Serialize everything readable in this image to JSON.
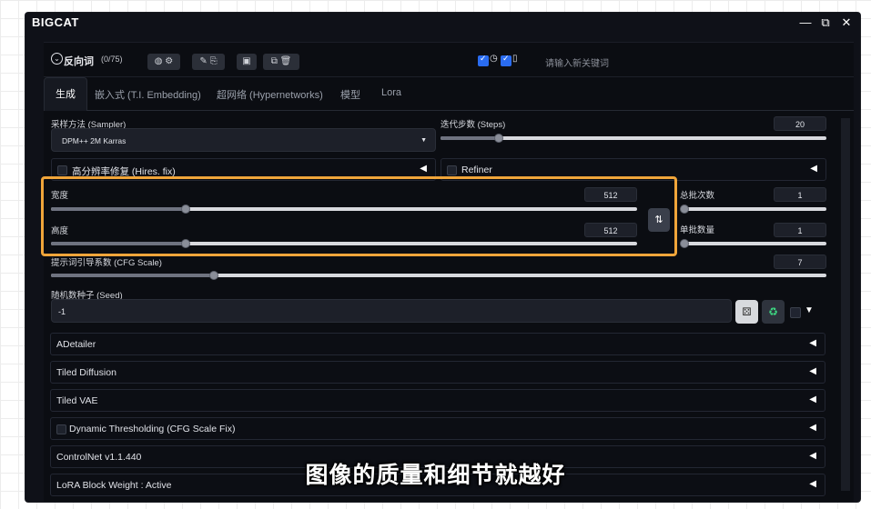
{
  "app": {
    "title": "BIGCAT"
  },
  "window_controls": {
    "minimize": "—",
    "restore": "⧉",
    "close": "✕"
  },
  "negative_prompt": {
    "title": "反向词",
    "count": "(0/75)",
    "keyword_placeholder": "请输入新关键词"
  },
  "tabs": [
    {
      "label": "生成",
      "active": true
    },
    {
      "label": "嵌入式 (T.I. Embedding)"
    },
    {
      "label": "超网络 (Hypernetworks)"
    },
    {
      "label": "模型"
    },
    {
      "label": "Lora"
    }
  ],
  "sampler": {
    "label": "采样方法 (Sampler)",
    "value": "DPM++ 2M Karras"
  },
  "steps": {
    "label": "迭代步数 (Steps)",
    "value": "20",
    "fraction": 0.15
  },
  "hires": {
    "label": "高分辨率修复 (Hires. fix)"
  },
  "refiner": {
    "label": "Refiner"
  },
  "width": {
    "label": "宽度",
    "value": "512",
    "fraction": 0.23
  },
  "height": {
    "label": "高度",
    "value": "512",
    "fraction": 0.23
  },
  "swap_icon": "⇅",
  "batch_count": {
    "label": "总批次数",
    "value": "1",
    "fraction": 0.0
  },
  "batch_size": {
    "label": "单批数量",
    "value": "1",
    "fraction": 0.0
  },
  "cfg": {
    "label": "提示词引导系数 (CFG Scale)",
    "value": "7",
    "fraction": 0.21
  },
  "seed": {
    "label": "随机数种子 (Seed)",
    "value": "-1"
  },
  "accordions": [
    {
      "label": "ADetailer",
      "checkbox": false
    },
    {
      "label": "Tiled Diffusion",
      "checkbox": false
    },
    {
      "label": "Tiled VAE",
      "checkbox": false
    },
    {
      "label": "Dynamic Thresholding (CFG Scale Fix)",
      "checkbox": true
    },
    {
      "label": "ControlNet v1.1.440",
      "checkbox": false
    },
    {
      "label": "LoRA Block Weight : Active",
      "checkbox": false
    }
  ],
  "subtitle": "图像的质量和细节就越好",
  "colors": {
    "highlight": "#f0a53a",
    "accent": "#2a6cf0",
    "recycle": "#3ddc84"
  }
}
